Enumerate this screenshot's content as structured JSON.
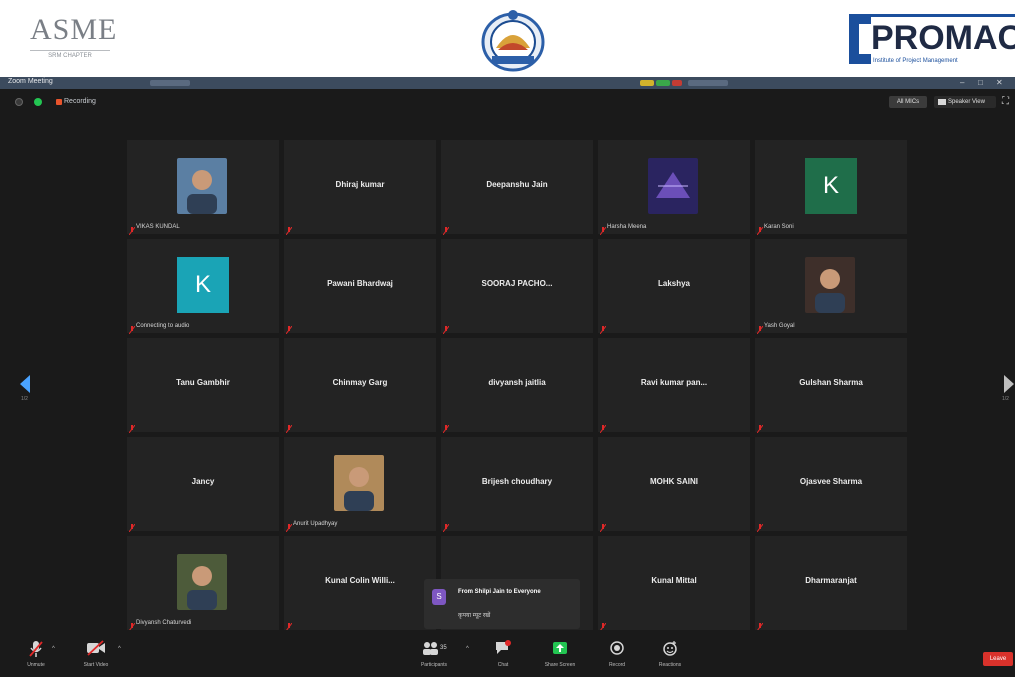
{
  "banner": {
    "asme_logo_text": "ASME",
    "asme_logo_sub": "SRM CHAPTER",
    "promac_logo_text": "PROMAC",
    "promac_logo_sub": "Institute of Project Management"
  },
  "window": {
    "title": "Zoom Meeting"
  },
  "topbar": {
    "recording_label": "Recording",
    "mute_all_label": "All MICs",
    "view_label": "Speaker View"
  },
  "participants": [
    {
      "name": "",
      "label": "VIKAS KUNDAL",
      "kind": "photo"
    },
    {
      "name": "Dhiraj kumar",
      "label": "",
      "kind": "name"
    },
    {
      "name": "Deepanshu Jain",
      "label": "",
      "kind": "name"
    },
    {
      "name": "",
      "label": "Harsha Meena",
      "kind": "image"
    },
    {
      "name": "",
      "label": "Karan Soni",
      "kind": "initial",
      "initial": "K",
      "color": "#1f6e4a"
    },
    {
      "name": "",
      "label": "Connecting to audio",
      "kind": "initial",
      "initial": "K",
      "color": "#1aa4b6"
    },
    {
      "name": "Pawani Bhardwaj",
      "label": "",
      "kind": "name"
    },
    {
      "name": "SOORAJ PACHO...",
      "label": "",
      "kind": "name"
    },
    {
      "name": "Lakshya",
      "label": "",
      "kind": "name"
    },
    {
      "name": "",
      "label": "Yash Goyal",
      "kind": "photo"
    },
    {
      "name": "Tanu Gambhir",
      "label": "",
      "kind": "name"
    },
    {
      "name": "Chinmay Garg",
      "label": "",
      "kind": "name"
    },
    {
      "name": "divyansh jaitlia",
      "label": "",
      "kind": "name"
    },
    {
      "name": "Ravi kumar pan...",
      "label": "",
      "kind": "name"
    },
    {
      "name": "Gulshan Sharma",
      "label": "",
      "kind": "name"
    },
    {
      "name": "Jancy",
      "label": "",
      "kind": "name"
    },
    {
      "name": "",
      "label": "Anurit Upadhyay",
      "kind": "photo"
    },
    {
      "name": "Brijesh choudhary",
      "label": "",
      "kind": "name"
    },
    {
      "name": "MOHK SAINI",
      "label": "",
      "kind": "name"
    },
    {
      "name": "Ojasvee Sharma",
      "label": "",
      "kind": "name"
    },
    {
      "name": "",
      "label": "Divyansh Chaturvedi",
      "kind": "photo"
    },
    {
      "name": "Kunal Colin Willi...",
      "label": "",
      "kind": "name"
    },
    {
      "name": "",
      "label": "",
      "kind": "blank"
    },
    {
      "name": "Kunal Mittal",
      "label": "",
      "kind": "name"
    },
    {
      "name": "Dharmaranjat",
      "label": "",
      "kind": "name"
    }
  ],
  "chat_popup": {
    "avatar_initial": "S",
    "from": "From Shilpi Jain to Everyone",
    "message": "कृपया म्यूट रखें"
  },
  "toolbar": {
    "unmute_label": "Unmute",
    "start_video_label": "Start Video",
    "participants_label": "Participants",
    "participants_count": "35",
    "chat_label": "Chat",
    "share_screen_label": "Share Screen",
    "record_label": "Record",
    "reactions_label": "Reactions",
    "leave_label": "Leave"
  },
  "colors": {
    "window_bg": "#1a1a1a",
    "tile_bg": "#232323",
    "leave_red": "#d9322b",
    "share_green": "#23c552",
    "mute_red": "#e02828"
  }
}
